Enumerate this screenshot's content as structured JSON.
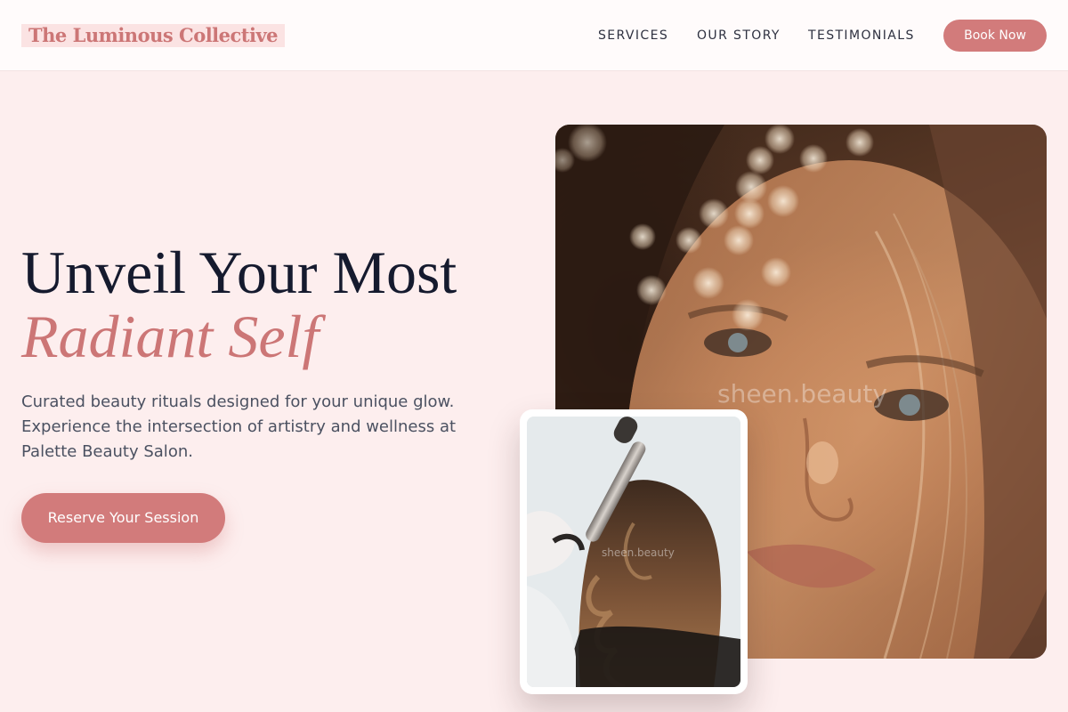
{
  "header": {
    "brand": "The Luminous Collective",
    "nav": {
      "services": "SERVICES",
      "our_story": "OUR STORY",
      "testimonials": "TESTIMONIALS"
    },
    "cta": "Book Now"
  },
  "hero": {
    "title_line1": "Unveil Your Most",
    "title_line2": "Radiant Self",
    "description": "Curated beauty rituals designed for your unique glow. Experience the intersection of artistry and wellness at Palette Beauty Salon.",
    "cta": "Reserve Your Session"
  },
  "media": {
    "main_photo_watermark": "sheen.beauty",
    "inset_photo_watermark": "sheen.beauty"
  },
  "colors": {
    "accent": "#d27b7b",
    "brand_text": "#cc7676",
    "background": "#fdeeee",
    "heading": "#151a2e",
    "body_text": "#4b5161"
  }
}
